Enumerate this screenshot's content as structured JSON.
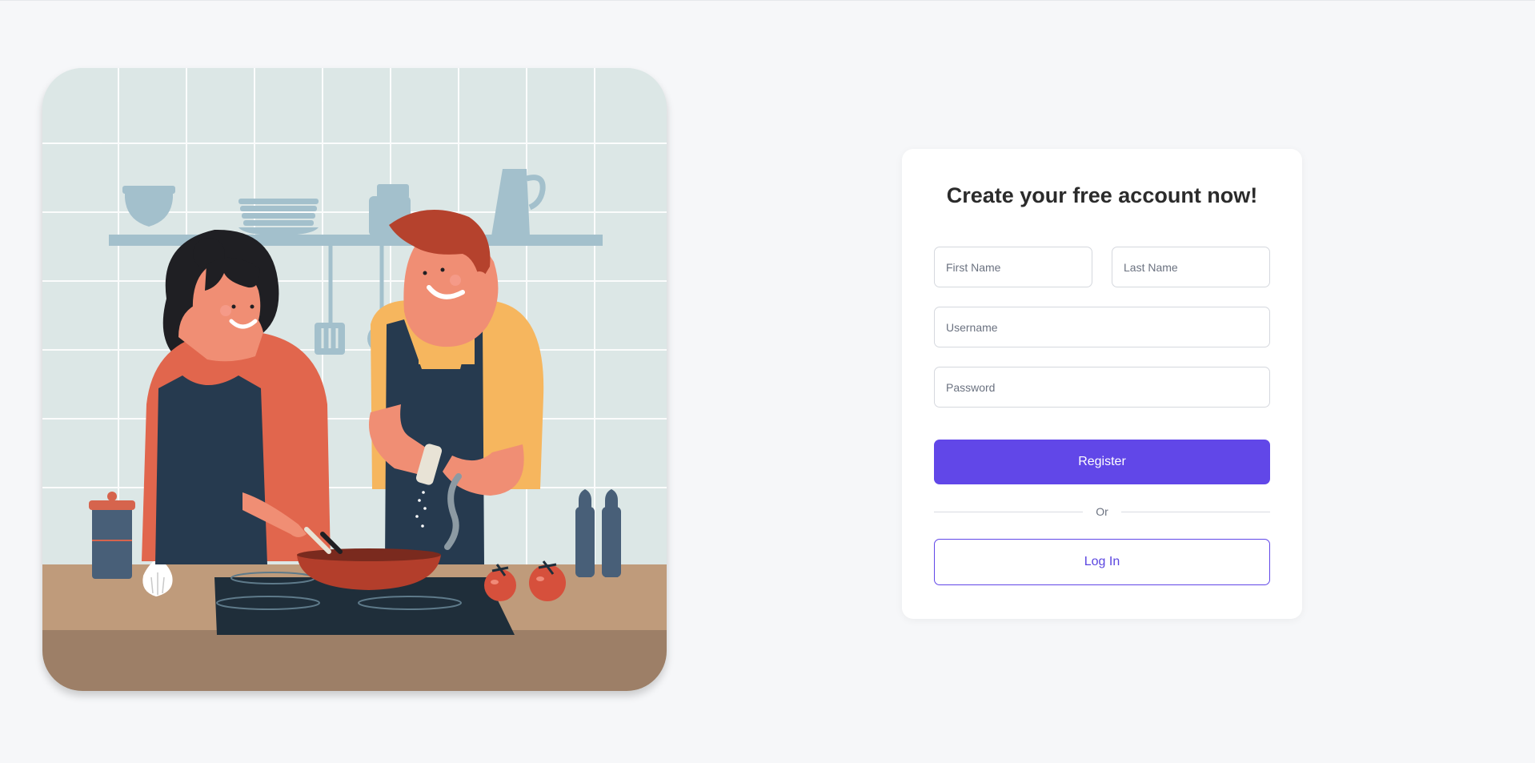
{
  "signup": {
    "title": "Create your free account now!",
    "first_name_placeholder": "First Name",
    "last_name_placeholder": "Last Name",
    "username_placeholder": "Username",
    "password_placeholder": "Password",
    "register_label": "Register",
    "divider_label": "Or",
    "login_label": "Log In"
  },
  "illustration": {
    "subject": "couple-cooking-illustration"
  },
  "colors": {
    "accent": "#6147e8",
    "background": "#f6f7f9",
    "card": "#ffffff"
  }
}
